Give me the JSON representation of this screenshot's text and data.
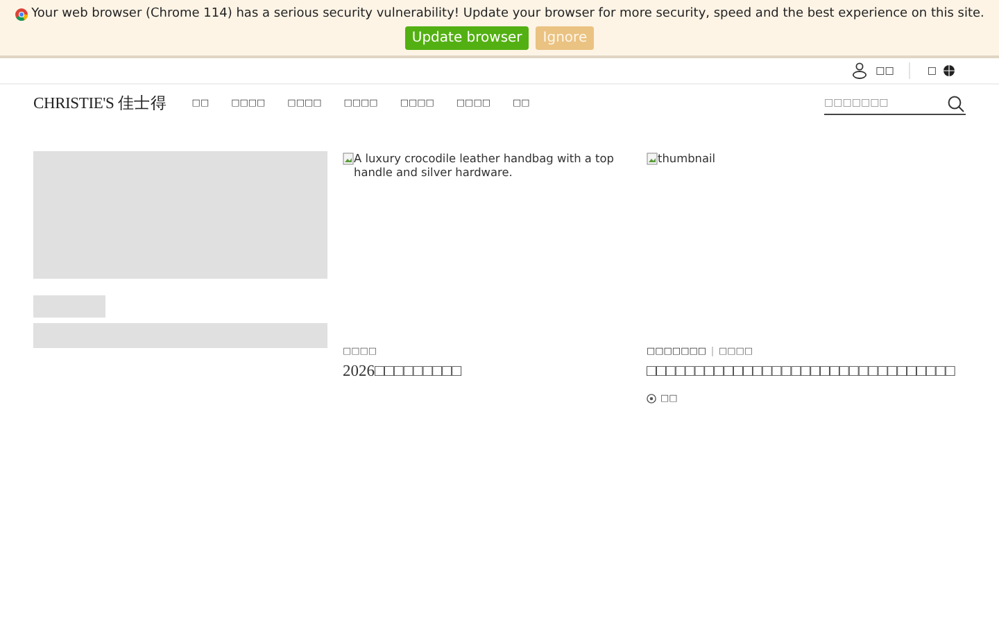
{
  "banner": {
    "message": "Your web browser (Chrome 114) has a serious security vulnerability! Update your browser for more security, speed and the best experience on this site.",
    "buttons": [
      {
        "label": "Update browser",
        "kind": "primary"
      },
      {
        "label": "Ignore",
        "kind": "secondary"
      }
    ]
  },
  "utility": {
    "login": "□□",
    "language": "□"
  },
  "header": {
    "logo": "CHRISTIE'S 佳士得",
    "nav": [
      "□□",
      "□□□□",
      "□□□□",
      "□□□□",
      "□□□□",
      "□□□□",
      "□□"
    ],
    "search": {
      "placeholder": "□□□□□□□"
    }
  },
  "cards": [
    {
      "kind": "skeleton"
    },
    {
      "kind": "article",
      "image_alt": "A luxury crocodile leather handbag with a top handle and silver hardware.",
      "tags": [
        "□□□□"
      ],
      "title": "2026□□□□□□□□□"
    },
    {
      "kind": "article",
      "image_alt": "thumbnail",
      "tags": [
        "□□□□□□□",
        "□□□□"
      ],
      "title": "□□□□□□□□□□□□□□□□□□□□□□□□□□□□□□□□",
      "location": "□□"
    }
  ]
}
